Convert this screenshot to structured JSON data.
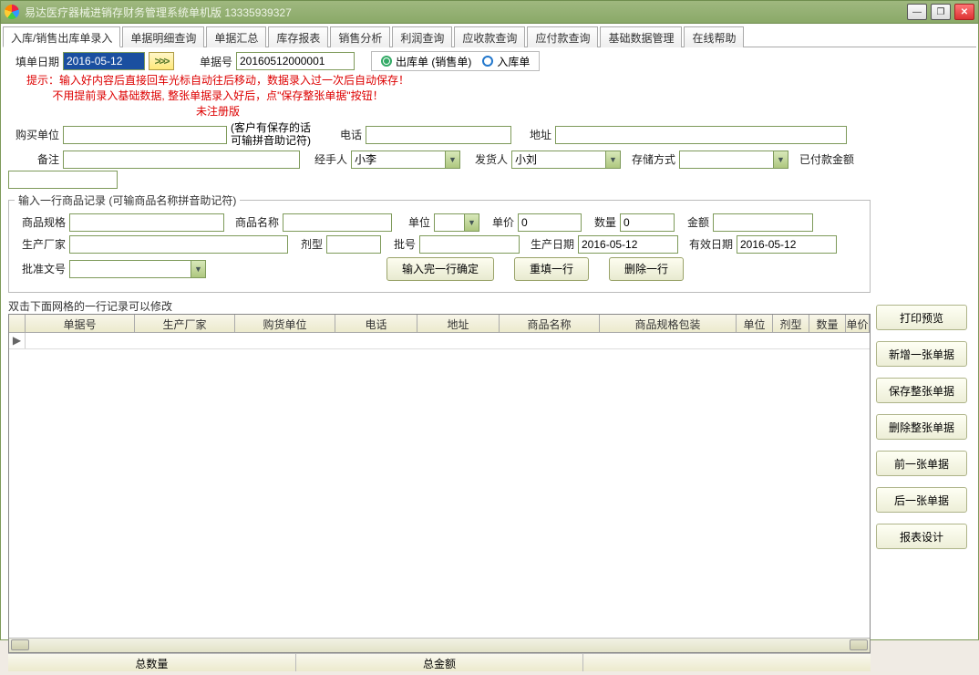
{
  "window": {
    "title": "易达医疗器械进销存财务管理系统单机版 13335939327"
  },
  "tabs": [
    "入库/销售出库单录入",
    "单据明细查询",
    "单据汇总",
    "库存报表",
    "销售分析",
    "利润查询",
    "应收款查询",
    "应付款查询",
    "基础数据管理",
    "在线帮助"
  ],
  "hint": {
    "l1": "提示：输入好内容后直接回车光标自动往后移动，数据录入过一次后自动保存！",
    "l2": "不用提前录入基础数据, 整张单据录入好后，点\"保存整张单据\"按钮！",
    "l3": "未注册版"
  },
  "form": {
    "fill_date_lbl": "填单日期",
    "fill_date": "2016-05-12",
    "arrow": ">>>",
    "bill_no_lbl": "单据号",
    "bill_no": "20160512000001",
    "radio_out": "出库单 (销售单)",
    "radio_in": "入库单",
    "buyer_lbl": "购买单位",
    "buyer_hint": "(客户有保存的话\n可输拼音助记符)",
    "phone_lbl": "电话",
    "addr_lbl": "地址",
    "remark_lbl": "备注",
    "handler_lbl": "经手人",
    "handler": "小李",
    "shipper_lbl": "发货人",
    "shipper": "小刘",
    "storage_lbl": "存储方式",
    "paid_lbl": "已付款金额"
  },
  "item_legend": "输入一行商品记录 (可输商品名称拼音助记符)",
  "item": {
    "spec_lbl": "商品规格",
    "name_lbl": "商品名称",
    "unit_lbl": "单位",
    "price_lbl": "单价",
    "price": "0",
    "qty_lbl": "数量",
    "qty": "0",
    "amount_lbl": "金额",
    "mfr_lbl": "生产厂家",
    "form_lbl": "剂型",
    "batch_lbl": "批号",
    "proddate_lbl": "生产日期",
    "proddate": "2016-05-12",
    "expdate_lbl": "有效日期",
    "expdate": "2016-05-12",
    "appno_lbl": "批准文号",
    "btn_confirm": "输入完一行确定",
    "btn_refill": "重填一行",
    "btn_del": "删除一行"
  },
  "grid_hint": "双击下面网格的一行记录可以修改",
  "grid_cols": [
    "单据号",
    "生产厂家",
    "购货单位",
    "电话",
    "地址",
    "商品名称",
    "商品规格包装",
    "单位",
    "剂型",
    "数量",
    "单价"
  ],
  "side_btns": [
    "打印预览",
    "新增一张单据",
    "保存整张单据",
    "删除整张单据",
    "前一张单据",
    "后一张单据",
    "报表设计"
  ],
  "footer": {
    "qty": "总数量",
    "amount": "总金额"
  }
}
